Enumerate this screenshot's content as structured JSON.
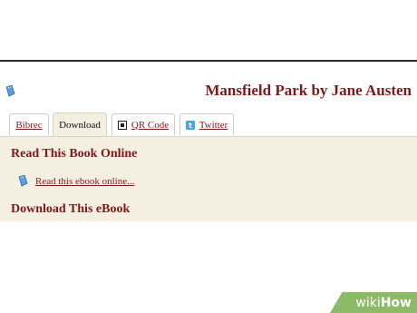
{
  "header": {
    "title": "Mansfield Park by Jane Austen",
    "icon": "ebook-icon"
  },
  "tabs": [
    {
      "label": "Bibrec",
      "active": false
    },
    {
      "label": "Download",
      "active": true
    },
    {
      "label": "QR Code",
      "active": false,
      "icon": "qr-code-icon"
    },
    {
      "label": "Twitter",
      "active": false,
      "icon": "twitter-icon"
    }
  ],
  "panel": {
    "read_heading": "Read This Book Online",
    "read_link": "Read this ebook online...",
    "download_heading": "Download This eBook"
  },
  "watermark": {
    "wiki": "wiki",
    "how": "How"
  },
  "colors": {
    "heading": "#7a1a1a",
    "panel_background": "#f4efe1",
    "watermark": "#8dba66"
  }
}
